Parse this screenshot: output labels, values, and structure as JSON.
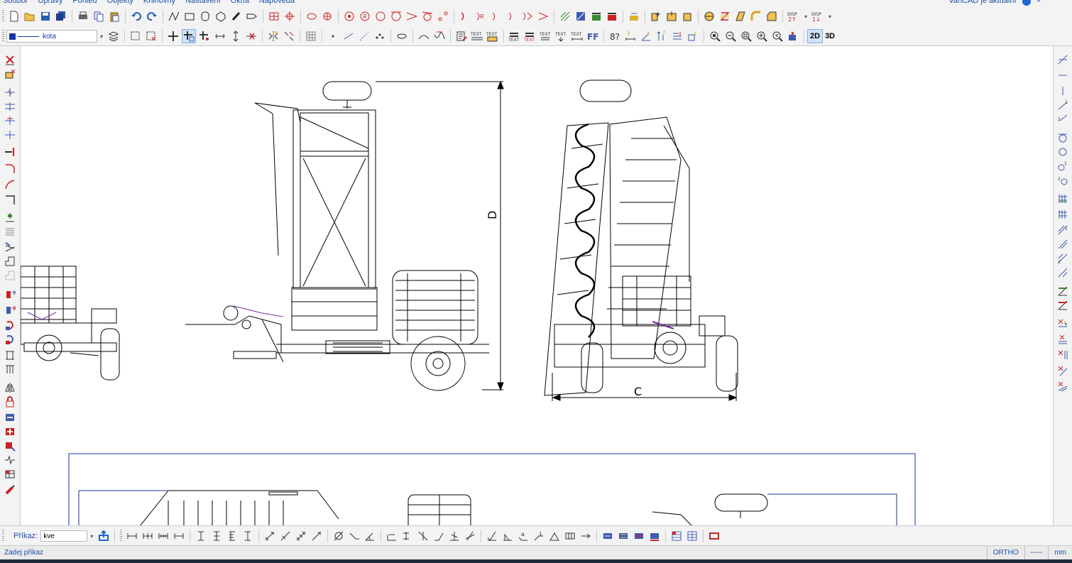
{
  "menu": {
    "items": [
      "Soubor",
      "Úpravy",
      "Pohled",
      "Objekty",
      "Knihovny",
      "Nastavení",
      "Okna",
      "Nápověda"
    ]
  },
  "status_top": {
    "text": "VariCAD je aktuální",
    "icon": "info-icon"
  },
  "layer": {
    "name": "kota",
    "color": "#1633a8"
  },
  "view_modes": {
    "two_d": "2D",
    "three_d": "3D",
    "active": "2D"
  },
  "disp_buttons": {
    "label": "DISP",
    "a": "2",
    "b": "1"
  },
  "drawing": {
    "dim_d": "D",
    "dim_c": "C"
  },
  "command": {
    "label": "Příkaz:",
    "value": "kve"
  },
  "statusbar": {
    "message": "Zadej příkaz",
    "ortho": "ORTHO",
    "snap": "-----",
    "units": "mm"
  },
  "colors": {
    "accent": "#1d4fa8",
    "layer": "#1633a8",
    "canvas_bg": "#ffffff",
    "toolbar_bg": "#f3f3f3"
  }
}
